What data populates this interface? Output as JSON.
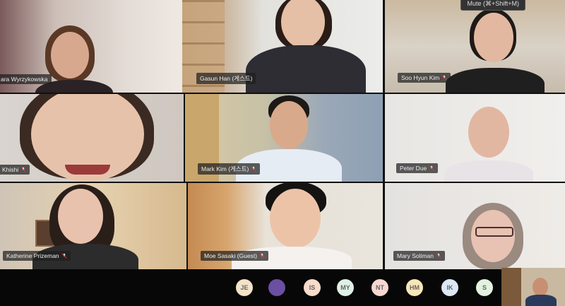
{
  "tooltip": "Mute (⌘+Shift+M)",
  "participants": [
    {
      "name": "ara Wyrzykowska"
    },
    {
      "name": "Gasun Han (게스트)"
    },
    {
      "name": "Soo Hyun Kim"
    },
    {
      "name": "Khishi"
    },
    {
      "name": "Mark Kim (게스트)"
    },
    {
      "name": "Peter Due"
    },
    {
      "name": "Katherine Prizeman"
    },
    {
      "name": "Moe Sasaki (Guest)"
    },
    {
      "name": "Mary Soliman"
    }
  ],
  "tray": [
    {
      "initials": "JE",
      "color": "#f3e3c9"
    },
    {
      "initials": "",
      "color": "#6a4fa3"
    },
    {
      "initials": "IS",
      "color": "#f7dccc"
    },
    {
      "initials": "MY",
      "color": "#dff0e4"
    },
    {
      "initials": "NT",
      "color": "#f7d8d0"
    },
    {
      "initials": "HM",
      "color": "#f6e6b8"
    },
    {
      "initials": "IK",
      "color": "#dce8f6"
    },
    {
      "initials": "S",
      "color": "#e2f2df"
    }
  ],
  "colors": {
    "tile_border": "#1a1a1a",
    "bar_bg": "#070707"
  }
}
